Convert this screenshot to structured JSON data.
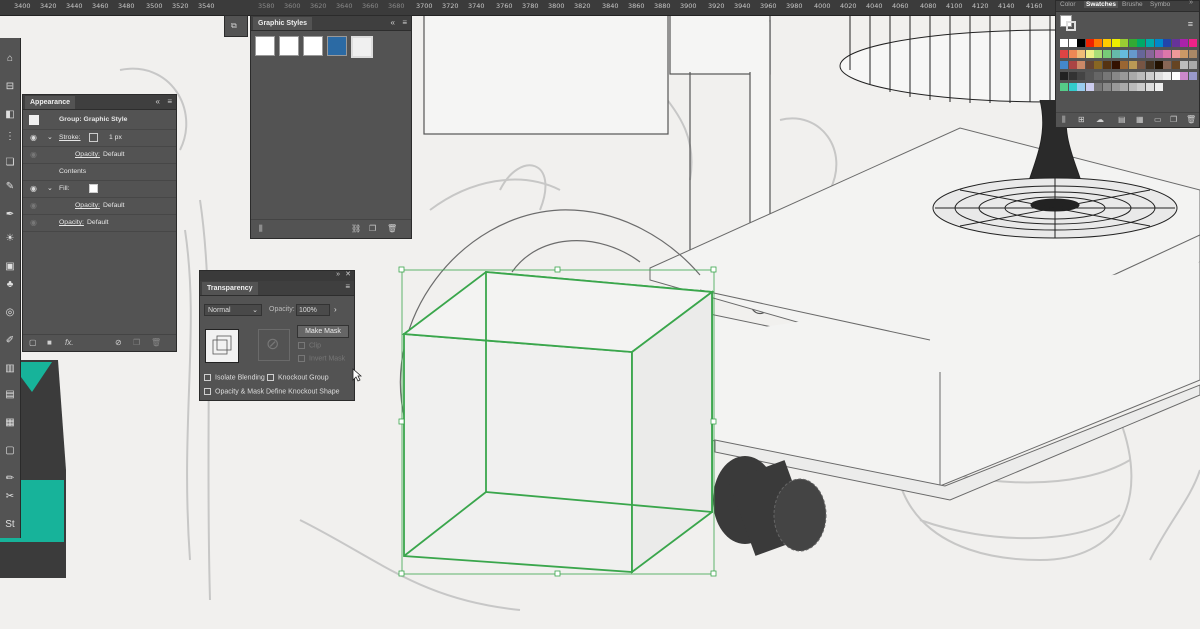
{
  "ruler": {
    "ticks_left": [
      "3400",
      "3420",
      "3440",
      "3460",
      "3480",
      "3500",
      "3520",
      "3540"
    ],
    "ticks_mid": [
      "3580",
      "3600",
      "3620",
      "3640",
      "3660",
      "3680"
    ],
    "ticks_right": [
      "3700",
      "3720",
      "3740",
      "3760",
      "3780",
      "3800",
      "3820",
      "3840",
      "3860",
      "3880",
      "3900",
      "3920",
      "3940",
      "3960",
      "3980",
      "4000",
      "4020",
      "4040",
      "4060",
      "4080",
      "4100",
      "4120",
      "4140",
      "4160"
    ]
  },
  "graphic_styles": {
    "title": "Graphic Styles",
    "icons": [
      "graphic-style-library-icon",
      "break-link-icon",
      "new-graphic-style-icon",
      "delete-icon"
    ]
  },
  "appearance": {
    "title": "Appearance",
    "group_label": "Group: Graphic Style",
    "stroke_label": "Stroke:",
    "stroke_value": "1 px",
    "stroke_opacity_label": "Opacity:",
    "stroke_opacity_value": "Default",
    "contents_label": "Contents",
    "fill_label": "Fill:",
    "fill_opacity_label": "Opacity:",
    "fill_opacity_value": "Default",
    "opacity_label": "Opacity:",
    "opacity_value": "Default",
    "fx_label": "fx."
  },
  "transparency": {
    "title": "Transparency",
    "blend_mode": "Normal",
    "opacity_label": "Opacity:",
    "opacity_value": "100%",
    "make_mask_label": "Make Mask",
    "clip_label": "Clip",
    "invert_mask_label": "Invert Mask",
    "isolate_label": "Isolate Blending",
    "knockout_label": "Knockout Group",
    "define_knockout_label": "Opacity & Mask Define Knockout Shape"
  },
  "swatches": {
    "tabs": [
      "Color",
      "Swatches",
      "Brushe",
      "Symbo"
    ],
    "active_tab": "Swatches"
  },
  "tools": {
    "bottom_label": "St"
  },
  "colors": {
    "panel_bg": "#535353",
    "panel_header": "#3f3f3f",
    "selection_green": "#3aa64c",
    "teal": "#17b39a",
    "canvas": "#f1f0ee"
  }
}
